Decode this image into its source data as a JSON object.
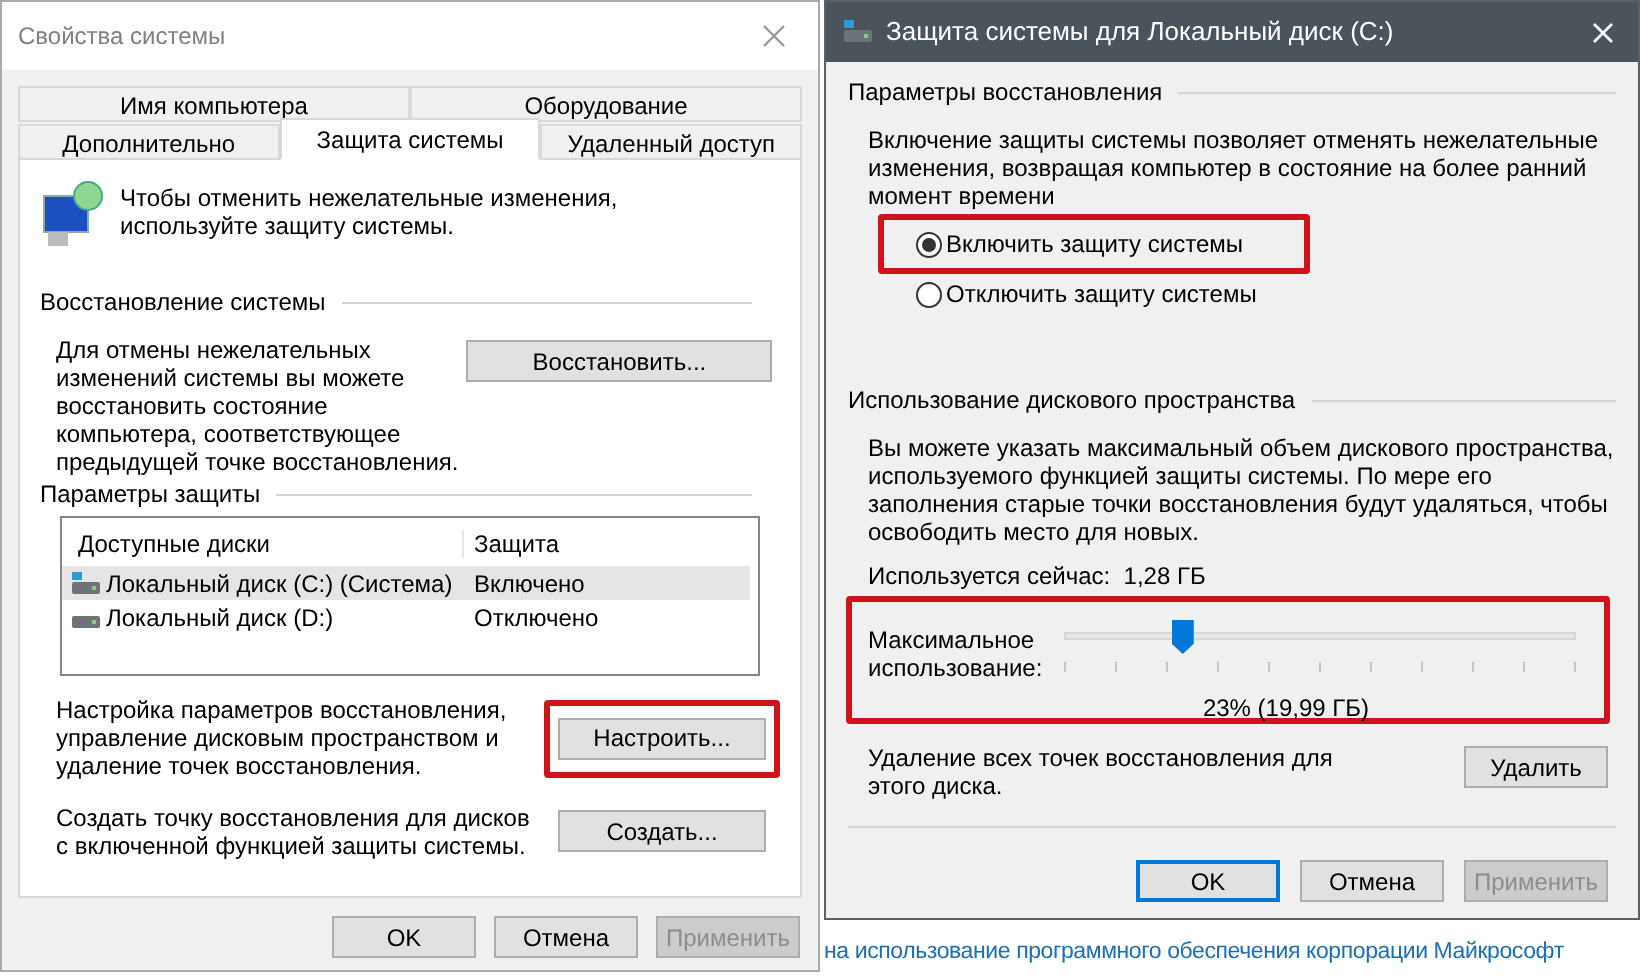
{
  "system_properties": {
    "title": "Свойства системы",
    "tabs_row_1": [
      {
        "label": "Имя компьютера",
        "selected": false
      },
      {
        "label": "Оборудование",
        "selected": false
      }
    ],
    "tabs_row_2": [
      {
        "label": "Дополнительно",
        "selected": false
      },
      {
        "label": "Защита системы",
        "selected": true
      },
      {
        "label": "Удаленный доступ",
        "selected": false
      }
    ],
    "intro_text": "Чтобы отменить нежелательные изменения, используйте защиту системы.",
    "restore_section": {
      "heading": "Восстановление системы",
      "description": "Для отмены нежелательных изменений системы вы можете восстановить состояние компьютера, соответствующее предыдущей точке восстановления.",
      "button": "Восстановить..."
    },
    "protection_section": {
      "heading": "Параметры защиты",
      "columns": [
        "Доступные диски",
        "Защита"
      ],
      "drives": [
        {
          "name": "Локальный диск (C:) (Система)",
          "protection": "Включено",
          "kind": "system",
          "selected": true
        },
        {
          "name": "Локальный диск (D:)",
          "protection": "Отключено",
          "kind": "data",
          "selected": false
        }
      ],
      "configure": {
        "text": "Настройка параметров восстановления, управление дисковым пространством и удаление точек восстановления.",
        "button": "Настроить...",
        "highlighted": true
      },
      "create": {
        "text": "Создать точку восстановления для дисков с включенной функцией защиты системы.",
        "button": "Создать...",
        "highlighted": false
      }
    },
    "buttons": [
      {
        "label": "OK",
        "disabled": false
      },
      {
        "label": "Отмена",
        "disabled": false
      },
      {
        "label": "Применить",
        "disabled": true
      }
    ]
  },
  "protection_dialog": {
    "title": "Защита системы для Локальный диск (C:)",
    "restore_settings": {
      "heading": "Параметры восстановления",
      "description": "Включение защиты системы позволяет отменять нежелательные изменения, возвращая компьютер в состояние на более ранний момент времени",
      "options": [
        {
          "label": "Включить защиту системы",
          "selected": true,
          "highlighted": true
        },
        {
          "label": "Отключить защиту системы",
          "selected": false,
          "highlighted": false
        }
      ]
    },
    "disk_usage": {
      "heading": "Использование дискового пространства",
      "description": "Вы можете указать максимальный объем дискового пространства, используемого функцией защиты системы. По мере его заполнения старые точки восстановления будут удаляться, чтобы освободить место для новых.",
      "current_usage": "Используется сейчас:  1,28 ГБ",
      "max_usage": {
        "label": "Максимальное использование:",
        "level": 0.23,
        "reading": "23% (19,99 ГБ)",
        "highlighted": true
      },
      "delete_text": "Удаление всех точек восстановления для этого диска.",
      "delete_button": "Удалить"
    },
    "buttons": [
      {
        "label": "OK",
        "default": true,
        "disabled": false
      },
      {
        "label": "Отмена",
        "default": false,
        "disabled": false
      },
      {
        "label": "Применить",
        "default": false,
        "disabled": true
      }
    ]
  },
  "background_link": "на использование программного обеспечения корпорации Майкрософт"
}
